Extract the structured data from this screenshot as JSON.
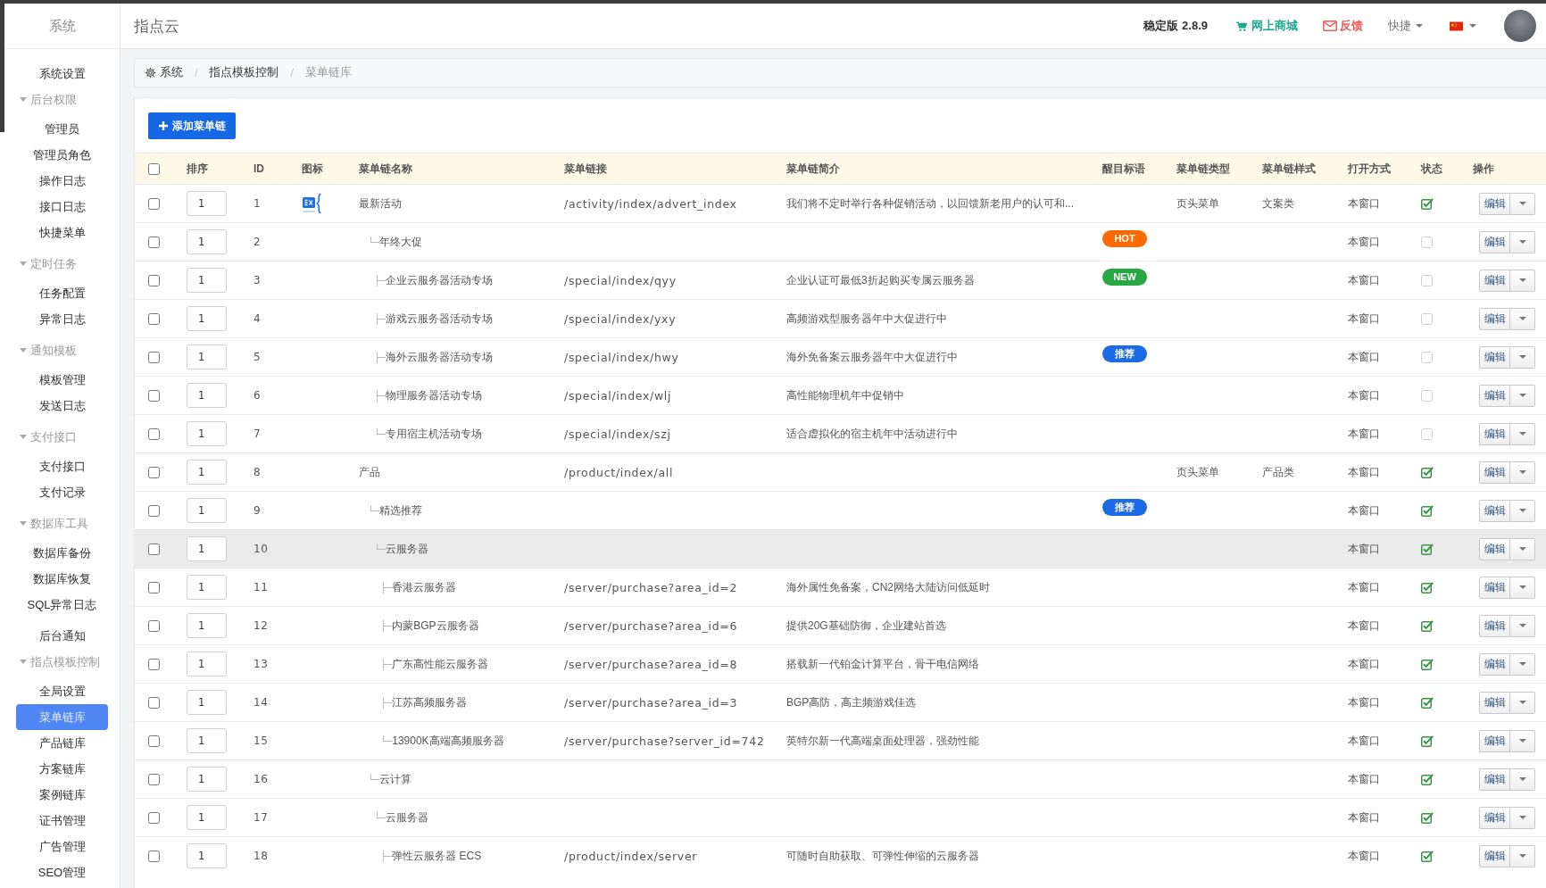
{
  "sidebar": {
    "title": "系统",
    "items": [
      {
        "kind": "link",
        "label": "系统设置",
        "selected": false
      },
      {
        "kind": "group",
        "label": "后台权限",
        "expanded": true,
        "children": [
          {
            "label": "管理员",
            "selected": false
          },
          {
            "label": "管理员角色",
            "selected": false
          },
          {
            "label": "操作日志",
            "selected": false
          },
          {
            "label": "接口日志",
            "selected": false
          },
          {
            "label": "快捷菜单",
            "selected": false
          }
        ]
      },
      {
        "kind": "group",
        "label": "定时任务",
        "expanded": true,
        "children": [
          {
            "label": "任务配置",
            "selected": false
          },
          {
            "label": "异常日志",
            "selected": false
          }
        ]
      },
      {
        "kind": "group",
        "label": "通知模板",
        "expanded": true,
        "children": [
          {
            "label": "模板管理",
            "selected": false
          },
          {
            "label": "发送日志",
            "selected": false
          }
        ]
      },
      {
        "kind": "group",
        "label": "支付接口",
        "expanded": true,
        "children": [
          {
            "label": "支付接口",
            "selected": false
          },
          {
            "label": "支付记录",
            "selected": false
          }
        ]
      },
      {
        "kind": "group",
        "label": "数据库工具",
        "expanded": true,
        "children": [
          {
            "label": "数据库备份",
            "selected": false
          },
          {
            "label": "数据库恢复",
            "selected": false
          },
          {
            "label": "SQL异常日志",
            "selected": false
          }
        ]
      },
      {
        "kind": "link",
        "label": "后台通知",
        "selected": false
      },
      {
        "kind": "group",
        "label": "指点模板控制",
        "expanded": true,
        "children": [
          {
            "label": "全局设置",
            "selected": false
          },
          {
            "label": "菜单链库",
            "selected": true
          },
          {
            "label": "产品链库",
            "selected": false
          },
          {
            "label": "方案链库",
            "selected": false
          },
          {
            "label": "案例链库",
            "selected": false
          },
          {
            "label": "证书管理",
            "selected": false
          },
          {
            "label": "广告管理",
            "selected": false
          },
          {
            "label": "SEO管理",
            "selected": false
          }
        ]
      }
    ]
  },
  "header": {
    "title": "指点云",
    "version": "稳定版 2.8.9",
    "store_link": "网上商城",
    "feedback_link": "反馈",
    "shortcuts": "快捷"
  },
  "breadcrumb": {
    "items": [
      {
        "label": "系统",
        "current": false
      },
      {
        "label": "指点模板控制",
        "current": false
      },
      {
        "label": "菜单链库",
        "current": true
      }
    ],
    "separators": [
      "/",
      "/"
    ]
  },
  "toolbar": {
    "add_button": "添加菜单链"
  },
  "table": {
    "all_selected": false,
    "columns": [
      "排序",
      "ID",
      "图标",
      "菜单链名称",
      "菜单链接",
      "菜单链简介",
      "醒目标语",
      "菜单链类型",
      "菜单链样式",
      "打开方式",
      "状态",
      "操作"
    ],
    "rows": [
      {
        "selected": false,
        "hovered": false,
        "sort": "1",
        "id": "1",
        "has_icon": true,
        "name": "最新活动",
        "link": "/activity/index/advert_index",
        "description": "我们将不定时举行各种促销活动，以回馈新老用户的认可和...",
        "type": "页头菜单",
        "style": "文案类",
        "open_mode": "本窗口",
        "enabled": true,
        "action": "编辑",
        "children": [
          {
            "selected": false,
            "hovered": false,
            "sort": "1",
            "id": "2",
            "has_icon": false,
            "branch": "└─",
            "name": "年终大促",
            "badge": {
              "text": "HOT",
              "color": "#ff6a00"
            },
            "open_mode": "本窗口",
            "enabled": false,
            "action": "编辑",
            "children": [
              {
                "selected": false,
                "hovered": false,
                "sort": "1",
                "id": "3",
                "has_icon": false,
                "branch": "├─",
                "name": "企业云服务器活动专场",
                "link": "/special/index/qyy",
                "description": "企业认证可最低3折起购买专属云服务器",
                "badge": {
                  "text": "NEW",
                  "color": "#28a745"
                },
                "open_mode": "本窗口",
                "enabled": false,
                "action": "编辑"
              },
              {
                "selected": false,
                "hovered": false,
                "sort": "1",
                "id": "4",
                "has_icon": false,
                "branch": "├─",
                "name": "游戏云服务器活动专场",
                "link": "/special/index/yxy",
                "description": "高频游戏型服务器年中大促进行中",
                "open_mode": "本窗口",
                "enabled": false,
                "action": "编辑"
              },
              {
                "selected": false,
                "hovered": false,
                "sort": "1",
                "id": "5",
                "has_icon": false,
                "branch": "├─",
                "name": "海外云服务器活动专场",
                "link": "/special/index/hwy",
                "description": "海外免备案云服务器年中大促进行中",
                "badge": {
                  "text": "推荐",
                  "color": "#1d6ae5"
                },
                "open_mode": "本窗口",
                "enabled": false,
                "action": "编辑"
              },
              {
                "selected": false,
                "hovered": false,
                "sort": "1",
                "id": "6",
                "has_icon": false,
                "branch": "├─",
                "name": "物理服务器活动专场",
                "link": "/special/index/wlj",
                "description": "高性能物理机年中促销中",
                "open_mode": "本窗口",
                "enabled": false,
                "action": "编辑"
              },
              {
                "selected": false,
                "hovered": false,
                "sort": "1",
                "id": "7",
                "has_icon": false,
                "branch": "└─",
                "name": "专用宿主机活动专场",
                "link": "/special/index/szj",
                "description": "适合虚拟化的宿主机年中活动进行中",
                "open_mode": "本窗口",
                "enabled": false,
                "action": "编辑"
              }
            ]
          }
        ]
      },
      {
        "selected": false,
        "hovered": false,
        "sort": "1",
        "id": "8",
        "has_icon": false,
        "name": "产品",
        "link": "/product/index/all",
        "type": "页头菜单",
        "style": "产品类",
        "open_mode": "本窗口",
        "enabled": true,
        "action": "编辑",
        "children": [
          {
            "selected": false,
            "hovered": false,
            "sort": "1",
            "id": "9",
            "has_icon": false,
            "branch": "└─",
            "name": "精选推荐",
            "badge": {
              "text": "推荐",
              "color": "#1d6ae5"
            },
            "open_mode": "本窗口",
            "enabled": true,
            "action": "编辑",
            "children": [
              {
                "selected": false,
                "hovered": true,
                "sort": "1",
                "id": "10",
                "has_icon": false,
                "branch": "└─",
                "name": "云服务器",
                "open_mode": "本窗口",
                "enabled": true,
                "action": "编辑",
                "children": [
                  {
                    "selected": false,
                    "hovered": false,
                    "sort": "1",
                    "id": "11",
                    "has_icon": false,
                    "branch": "├─",
                    "name": "香港云服务器",
                    "link": "/server/purchase?area_id=2",
                    "description": "海外属性免备案，CN2网络大陆访问低延时",
                    "open_mode": "本窗口",
                    "enabled": true,
                    "action": "编辑"
                  },
                  {
                    "selected": false,
                    "hovered": false,
                    "sort": "1",
                    "id": "12",
                    "has_icon": false,
                    "branch": "├─",
                    "name": "内蒙BGP云服务器",
                    "link": "/server/purchase?area_id=6",
                    "description": "提供20G基础防御，企业建站首选",
                    "open_mode": "本窗口",
                    "enabled": true,
                    "action": "编辑"
                  },
                  {
                    "selected": false,
                    "hovered": false,
                    "sort": "1",
                    "id": "13",
                    "has_icon": false,
                    "branch": "├─",
                    "name": "广东高性能云服务器",
                    "link": "/server/purchase?area_id=8",
                    "description": "搭载新一代铂金计算平台，骨干电信网络",
                    "open_mode": "本窗口",
                    "enabled": true,
                    "action": "编辑"
                  },
                  {
                    "selected": false,
                    "hovered": false,
                    "sort": "1",
                    "id": "14",
                    "has_icon": false,
                    "branch": "├─",
                    "name": "江苏高频服务器",
                    "link": "/server/purchase?area_id=3",
                    "description": "BGP高防，高主频游戏佳选",
                    "open_mode": "本窗口",
                    "enabled": true,
                    "action": "编辑"
                  },
                  {
                    "selected": false,
                    "hovered": false,
                    "sort": "1",
                    "id": "15",
                    "has_icon": false,
                    "branch": "└─",
                    "name": "13900K高端高频服务器",
                    "link": "/server/purchase?server_id=742",
                    "description": "英特尔新一代高端桌面处理器，强劲性能",
                    "open_mode": "本窗口",
                    "enabled": true,
                    "action": "编辑"
                  }
                ]
              }
            ]
          },
          {
            "selected": false,
            "hovered": false,
            "sort": "1",
            "id": "16",
            "has_icon": false,
            "branch": "└─",
            "name": "云计算",
            "open_mode": "本窗口",
            "enabled": true,
            "action": "编辑",
            "children": [
              {
                "selected": false,
                "hovered": false,
                "sort": "1",
                "id": "17",
                "has_icon": false,
                "branch": "└─",
                "name": "云服务器",
                "open_mode": "本窗口",
                "enabled": true,
                "action": "编辑",
                "children": [
                  {
                    "selected": false,
                    "hovered": false,
                    "sort": "1",
                    "id": "18",
                    "has_icon": false,
                    "branch": "├─",
                    "name": "弹性云服务器 ECS",
                    "link": "/product/index/server",
                    "description": "可随时自助获取、可弹性伸缩的云服务器",
                    "open_mode": "本窗口",
                    "enabled": true,
                    "action": "编辑"
                  }
                ]
              }
            ]
          }
        ]
      }
    ]
  }
}
